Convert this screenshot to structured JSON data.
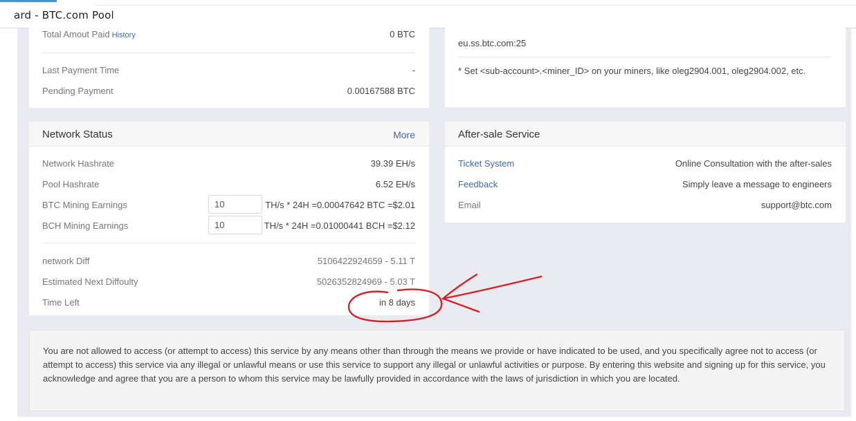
{
  "window": {
    "title": "ard - BTC.com Pool"
  },
  "earnings_card": {
    "total_paid_label": "Total Amout Paid",
    "history_link": "History",
    "total_paid_value": "0 BTC",
    "last_payment_label": "Last Payment Time",
    "last_payment_value": "-",
    "pending_label": "Pending Payment",
    "pending_value": "0.00167588 BTC"
  },
  "connection_card": {
    "server": "eu.ss.btc.com:25",
    "note": "* Set <sub-account>.<miner_ID> on your miners, like oleg2904.001, oleg2904.002, etc."
  },
  "network_status": {
    "title": "Network Status",
    "more_label": "More",
    "network_hashrate_label": "Network Hashrate",
    "network_hashrate_value": "39.39 EH/s",
    "pool_hashrate_label": "Pool Hashrate",
    "pool_hashrate_value": "6.52 EH/s",
    "btc_earnings_label": "BTC Mining Earnings",
    "btc_input_value": "10",
    "btc_earnings_text": "TH/s * 24H =0.00047642 BTC =$2.01",
    "bch_earnings_label": "BCH Mining Earnings",
    "bch_input_value": "10",
    "bch_earnings_text": "TH/s * 24H =0.01000441 BCH =$2.12",
    "network_diff_label": "network Diff",
    "network_diff_value": "5106422924659 - 5.11 T",
    "next_diff_label": "Estimated Next Diffoulty",
    "next_diff_value": "5026352824969 - 5.03 T",
    "time_left_label": "Time Left",
    "time_left_value": "in 8 days"
  },
  "after_sale": {
    "title": "After-sale Service",
    "ticket_label": "Ticket System",
    "ticket_value": "Online Consultation with the after-sales",
    "feedback_label": "Feedback",
    "feedback_value": "Simply leave a message to engineers",
    "email_label": "Email",
    "email_value": "support@btc.com"
  },
  "disclaimer": {
    "text": "You are not allowed to access (or attempt to access) this service by any means other than through the means we provide or have indicated to be used, and you specifically agree not to access (or attempt to access) this service via any illegal or unlawful means or use this service to support any illegal or unlawful activities or purpose. By entering this website and signing up for this service, you acknowledge and agree that you are a person to whom this service may be lawfully provided in accordance with the laws of jurisdiction in which you are located."
  },
  "colors": {
    "annotation": "#d81f26",
    "link": "#3d6aa8",
    "background": "#e9ebf0"
  }
}
